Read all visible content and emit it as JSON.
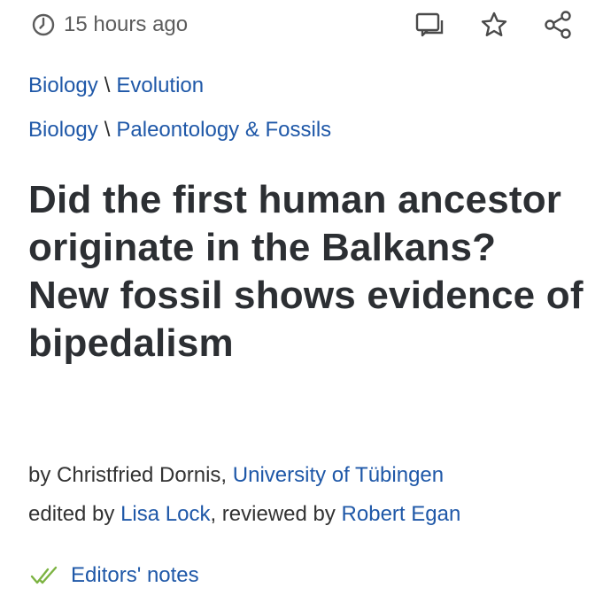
{
  "meta": {
    "time_ago": "15 hours ago"
  },
  "breadcrumbs": [
    {
      "parent": "Biology",
      "separator": "\\",
      "child": "Evolution"
    },
    {
      "parent": "Biology",
      "separator": "\\",
      "child": "Paleontology & Fossils"
    }
  ],
  "article": {
    "title": "Did the first human ancestor originate in the Balkans? New fossil shows evidence of bipedalism"
  },
  "byline": {
    "by_prefix": "by",
    "author": "Christfried Dornis",
    "comma": ",",
    "institution": "University of Tübingen",
    "edited_prefix": "edited by",
    "editor": "Lisa Lock",
    "reviewed_prefix": ", reviewed by",
    "reviewer": "Robert Egan"
  },
  "editors_notes": {
    "label": "Editors' notes"
  },
  "icons": {
    "time": "clock-icon",
    "comments": "comments-icon",
    "bookmark": "star-icon",
    "share": "share-icon",
    "check": "double-check-icon"
  },
  "colors": {
    "link": "#1f58a8",
    "title": "#2c2f33",
    "muted": "#5c5c5c",
    "check": "#7cb342"
  }
}
